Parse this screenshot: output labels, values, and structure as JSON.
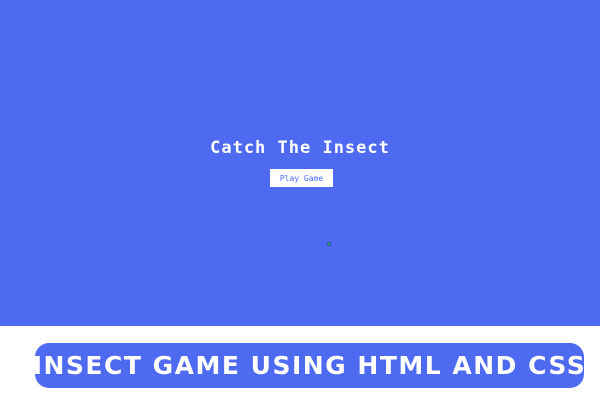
{
  "game": {
    "title": "Catch The Insect",
    "play_button_label": "Play Game",
    "background_color": "#4d6af0",
    "button_text_color": "#4d6af0"
  },
  "banner": {
    "text": "INSECT GAME USING HTML AND CSS",
    "background_color": "#4d6af0"
  },
  "cursor": {
    "icon": "pointer-dot-icon"
  }
}
